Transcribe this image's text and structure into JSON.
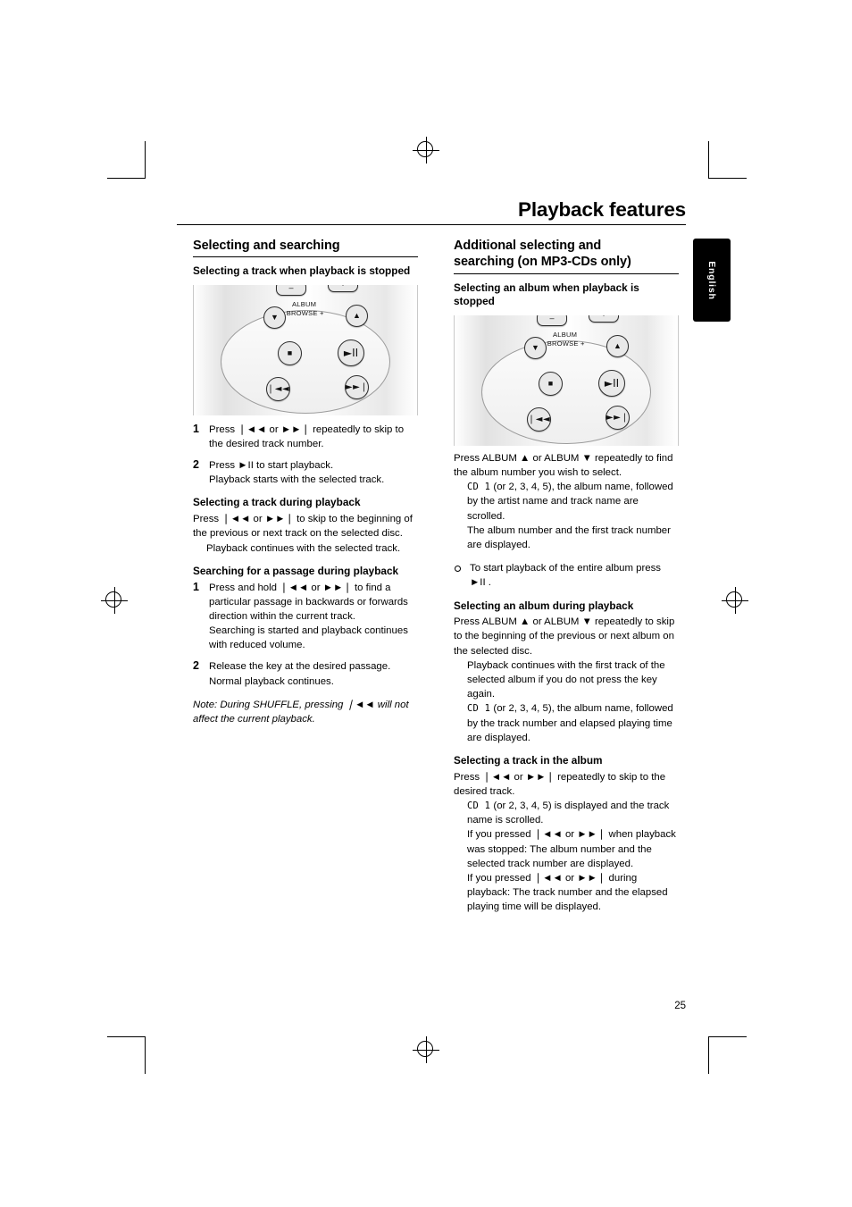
{
  "document": {
    "title": "Playback features",
    "page_number": "25",
    "side_tab": "English"
  },
  "left_column": {
    "section_title": "Selecting and searching",
    "sub1": {
      "heading": "Selecting a track when playback is stopped",
      "steps": [
        {
          "num": "1",
          "text": "Press ❘◄◄ or ►►❘ repeatedly to skip to the desired track number."
        },
        {
          "num": "2",
          "text": "Press  ►II  to start playback.",
          "indent": "Playback starts with the selected track."
        }
      ]
    },
    "sub2": {
      "heading": "Selecting a track during playback",
      "body": "Press ❘◄◄ or ►►❘ to skip to the beginning of the previous or next track on the selected disc.",
      "indent": "Playback continues with the selected track."
    },
    "sub3": {
      "heading": "Searching for a passage during playback",
      "steps": [
        {
          "num": "1",
          "text": "Press and hold ❘◄◄ or ►►❘ to find a particular passage in backwards or forwards direction within the current track.",
          "indent": "Searching is started and playback continues with reduced volume."
        },
        {
          "num": "2",
          "text": "Release the key at the desired passage.",
          "indent": "Normal playback continues."
        }
      ],
      "note": "Note: During SHUFFLE, pressing ❘◄◄ will not affect the current playback."
    },
    "remote_labels": {
      "minus": "–",
      "plus": "+",
      "album": "ALBUM",
      "browse": "– BROWSE +",
      "up": "▲",
      "down": "▼",
      "stop": "■",
      "play_pause": "►II",
      "prev": "❘◄◄",
      "next": "►►❘"
    }
  },
  "right_column": {
    "section_title_line1": "Additional selecting and",
    "section_title_line2": "searching (on MP3-CDs only)",
    "sub1": {
      "heading": "Selecting an album when playback is stopped",
      "body": "Press ALBUM ▲ or ALBUM ▼ repeatedly to find the album number you wish to select.",
      "indent1_mono": "CD 1",
      "indent1_rest": " (or 2, 3, 4, 5), the album name, followed by the artist name and track name are scrolled.",
      "indent2": "The album number and the first track number are displayed.",
      "bullet": "To start playback of the entire album press ►II ."
    },
    "sub2": {
      "heading": "Selecting an album during playback",
      "body": "Press ALBUM ▲ or ALBUM ▼ repeatedly to skip to the beginning of the previous or next album on the selected disc.",
      "indent1": "Playback continues with the first track of the selected album if you do not press the key again.",
      "indent2_mono": "CD 1",
      "indent2_rest": " (or 2, 3, 4, 5), the album name, followed by the track number and elapsed playing time are displayed."
    },
    "sub3": {
      "heading": "Selecting a track in the album",
      "body": "Press ❘◄◄ or ►►❘ repeatedly to skip to the desired track.",
      "indent1_mono": "CD 1",
      "indent1_rest": " (or 2, 3, 4, 5) is displayed and the track name is scrolled.",
      "indent2": "If you pressed ❘◄◄ or ►►❘ when playback was stopped: The album number and the selected track number are displayed.",
      "indent3": "If you pressed ❘◄◄ or ►►❘ during playback: The track number and the elapsed playing time will be displayed."
    }
  }
}
